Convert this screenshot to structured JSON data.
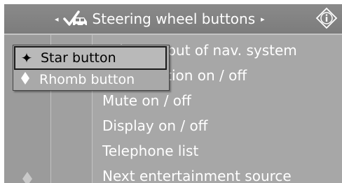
{
  "header": {
    "title": "Steering wheel buttons",
    "prev_arrow": "◂",
    "next_arrow": "▸",
    "car_icon": "car-check-icon",
    "info_icon": "info-icon"
  },
  "popup": {
    "items": [
      {
        "label": "Star button",
        "icon": "star-icon",
        "selected": true
      },
      {
        "label": "Rhomb button",
        "icon": "rhomb-icon",
        "selected": false
      }
    ]
  },
  "list": {
    "items": [
      {
        "label": "Voice output of nav. system"
      },
      {
        "label": "Recirculation on / off"
      },
      {
        "label": "Mute on / off"
      },
      {
        "label": "Display on / off"
      },
      {
        "label": "Telephone list"
      },
      {
        "label": "Next entertainment source"
      }
    ]
  },
  "colors": {
    "background": "#a7a7a7",
    "header": "#7c7c7c",
    "text": "#ffffff"
  }
}
